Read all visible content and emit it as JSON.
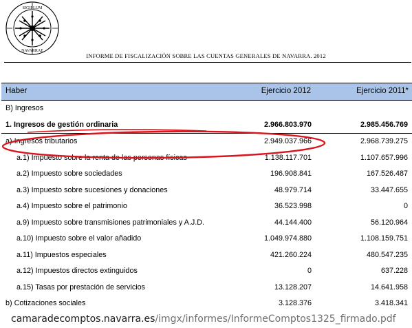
{
  "header": {
    "seal_text": "SIGILLUM REGNI NAVARRAE",
    "title": "INFORME DE FISCALIZACIÓN SOBRE LAS CUENTAS GENERALES DE NAVARRA. 2012"
  },
  "table": {
    "columns": [
      "Haber",
      "Ejercicio 2012",
      "Ejercicio 2011*"
    ],
    "rows": [
      {
        "label": "B) Ingresos",
        "v2012": "",
        "v2011": ""
      },
      {
        "label": "1. Ingresos de gestión ordinaria",
        "v2012": "2.966.803.970",
        "v2011": "2.985.456.769"
      },
      {
        "label": "a) Ingresos tributarios",
        "v2012": "2.949.037.966",
        "v2011": "2.968.739.275"
      },
      {
        "label": "a.1) Impuesto sobre la renta de las personas físicas",
        "v2012": "1.138.117.701",
        "v2011": "1.107.657.996"
      },
      {
        "label": "a.2) Impuesto sobre sociedades",
        "v2012": "196.908.841",
        "v2011": "167.526.487"
      },
      {
        "label": "a.3) Impuesto sobre sucesiones y donaciones",
        "v2012": "48.979.714",
        "v2011": "33.447.655"
      },
      {
        "label": "a.4) Impuesto sobre el patrimonio",
        "v2012": "36.523.998",
        "v2011": "0"
      },
      {
        "label": "a.9) Impuesto sobre transmisiones patrimoniales y A.J.D.",
        "v2012": "44.144.400",
        "v2011": "56.120.964"
      },
      {
        "label": "a.10) Impuesto sobre el valor añadido",
        "v2012": "1.049.974.880",
        "v2011": "1.108.159.751"
      },
      {
        "label": "a.11) Impuestos especiales",
        "v2012": "421.260.224",
        "v2011": "480.547.235"
      },
      {
        "label": "a.12) Impuestos directos extinguidos",
        "v2012": "0",
        "v2011": "637.228"
      },
      {
        "label": "a.15) Tasas por prestación de servicios",
        "v2012": "13.128.207",
        "v2011": "14.641.958"
      },
      {
        "label": "b) Cotizaciones sociales",
        "v2012": "3.128.376",
        "v2011": "3.418.341"
      }
    ]
  },
  "annotation": {
    "color": "#d8141c"
  },
  "source": {
    "domain": "camaradecomptos.navarra.es",
    "path": "/imgx/informes/InformeComptos1325_firmado.pdf"
  },
  "colors": {
    "header_bg": "#a9c4e8"
  }
}
